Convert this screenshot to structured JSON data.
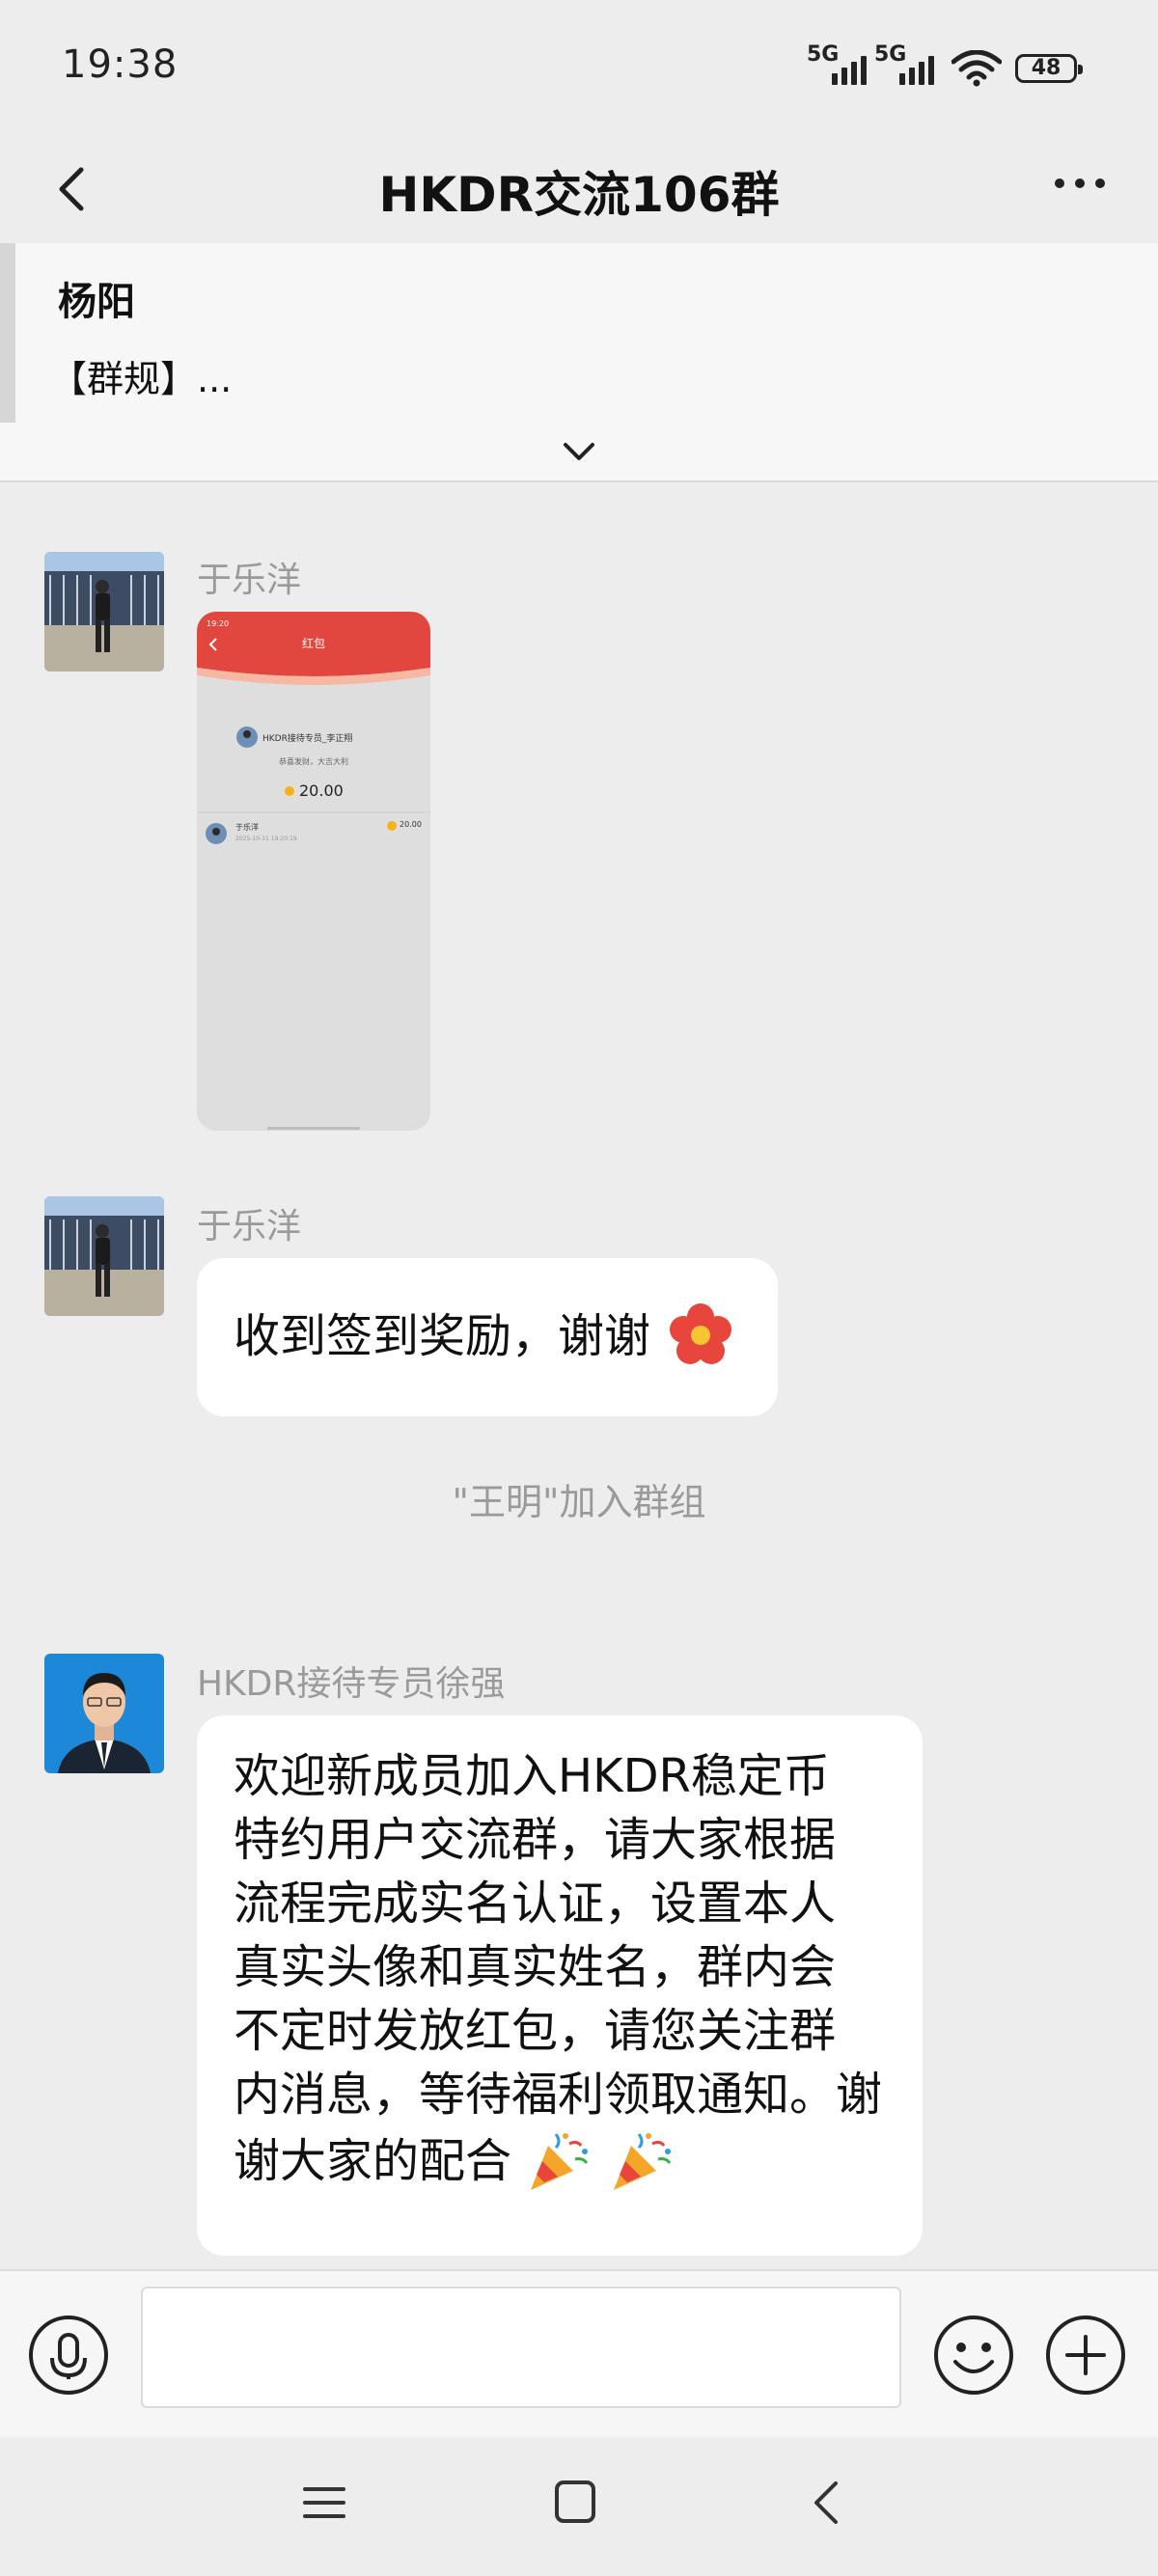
{
  "status_bar": {
    "time": "19:38",
    "network1": "5G",
    "network2": "5G",
    "battery": "48"
  },
  "header": {
    "title": "HKDR交流106群"
  },
  "pinned": {
    "sender": "杨阳",
    "text": "【群规】..."
  },
  "messages": [
    {
      "sender": "于乐洋",
      "type": "image",
      "screenshot": {
        "time": "19:20",
        "title": "红包",
        "from": "HKDR接待专员_李正翔",
        "blessing": "恭喜发财，大吉大利",
        "amount": "20.00",
        "receiver_name": "于乐洋",
        "receiver_time": "2025-10-11 19:20:19",
        "receiver_amount": "20.00"
      }
    },
    {
      "sender": "于乐洋",
      "type": "text",
      "text": "收到签到奖励，谢谢"
    },
    {
      "type": "system",
      "text": "\"王明\"加入群组"
    },
    {
      "sender": "HKDR接待专员徐强",
      "type": "text",
      "lines": [
        "欢迎新成员加入HKDR稳定币",
        "特约用户交流群，请大家根据",
        "流程完成实名认证，设置本人",
        "真实头像和真实姓名，群内会",
        "不定时发放红包，请您关注群",
        "内消息，等待福利领取通知。谢",
        "谢大家的配合"
      ]
    }
  ],
  "colors": {
    "background": "#ededed",
    "bubble": "#ffffff",
    "packet_red": "#e2473f",
    "coin": "#f5b316"
  }
}
